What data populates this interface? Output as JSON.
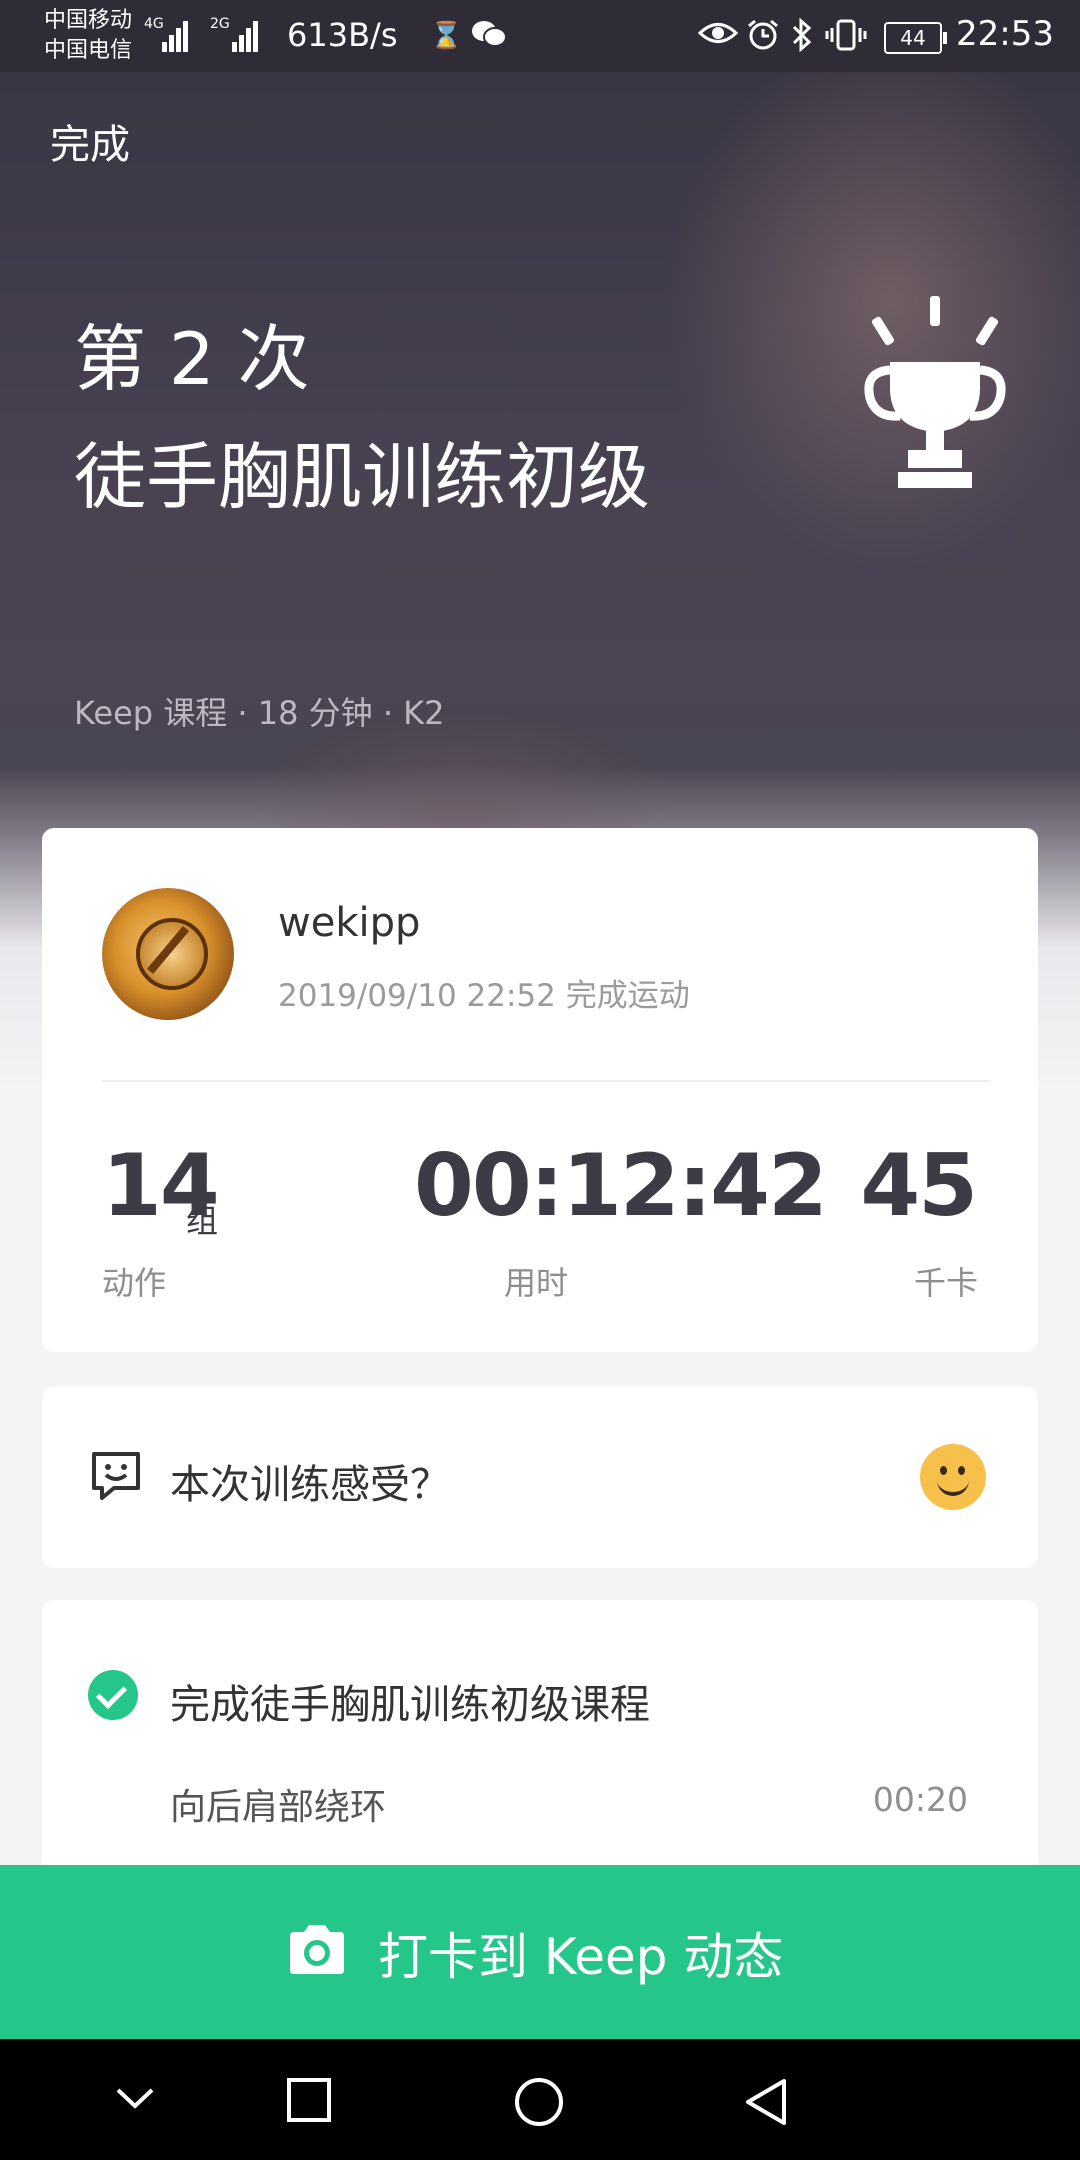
{
  "status_bar": {
    "carrier_1": "中国移动",
    "carrier_2": "中国电信",
    "signal_1_type": "4G",
    "signal_2_type": "2G",
    "net_speed": "613B/s",
    "battery": "44",
    "time": "22:53"
  },
  "hero": {
    "done_label": "完成",
    "title_line_1": "第 2 次",
    "title_line_2": "徒手胸肌训练初级",
    "meta": "Keep 课程 · 18 分钟 · K2"
  },
  "record": {
    "username": "wekipp",
    "completed_at": "2019/09/10 22:52 完成运动",
    "stats": [
      {
        "value": "14",
        "unit": "组",
        "label": "动作"
      },
      {
        "value": "00:12:42",
        "unit": "",
        "label": "用时"
      },
      {
        "value": "45",
        "unit": "",
        "label": "千卡"
      }
    ]
  },
  "feeling": {
    "prompt": "本次训练感受？"
  },
  "course": {
    "title": "完成徒手胸肌训练初级课程",
    "exercises": [
      {
        "name": "向后肩部绕环",
        "duration": "00:20"
      },
      {
        "name": "",
        "duration": ""
      }
    ]
  },
  "checkin_button": {
    "label": "打卡到 Keep 动态"
  },
  "colors": {
    "accent_green": "#24c789",
    "hero_bg": "#4a4552"
  }
}
